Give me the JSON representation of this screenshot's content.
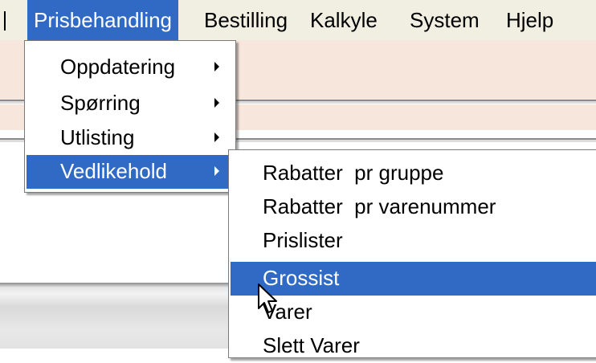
{
  "menubar": {
    "items": [
      {
        "label": "Prisbehandling",
        "active": true
      },
      {
        "label": "Bestilling",
        "active": false
      },
      {
        "label": "Kalkyle",
        "active": false
      },
      {
        "label": "System",
        "active": false
      },
      {
        "label": "Hjelp",
        "active": false
      }
    ]
  },
  "prisbehandling_menu": {
    "items": [
      {
        "label": "Oppdatering",
        "submenu": true
      },
      {
        "label": "Spørring",
        "submenu": true
      },
      {
        "label": "Utlisting",
        "submenu": true
      },
      {
        "label": "Vedlikehold",
        "submenu": true,
        "selected": true
      }
    ]
  },
  "vedlikehold_menu": {
    "items": [
      {
        "label": "Rabatter  pr gruppe"
      },
      {
        "label": "Rabatter  pr varenummer"
      },
      {
        "label": "Prislister"
      },
      {
        "label": "Grossist",
        "selected": true
      },
      {
        "label": "Varer"
      },
      {
        "label": "Slett Varer"
      }
    ]
  },
  "colors": {
    "menubar_bg": "#f1efe2",
    "selection": "#316ac5",
    "toolbar_bg": "#f7e6dc"
  },
  "icons": {
    "cursor": "arrow-pointer-icon",
    "submenu": "triangle-right-icon"
  }
}
